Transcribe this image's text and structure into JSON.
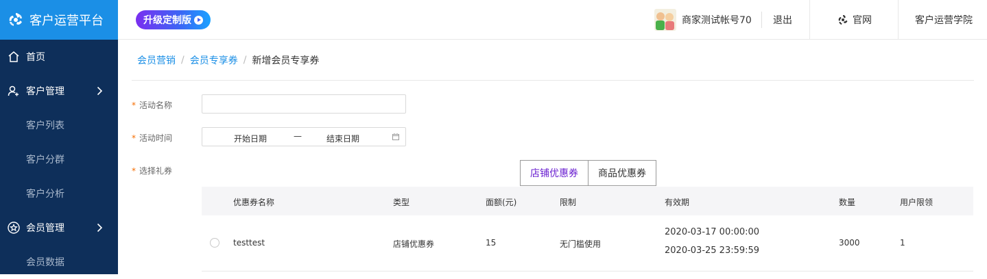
{
  "header": {
    "app_title": "客户运营平台",
    "upgrade_label": "升级定制版",
    "account_name": "商家测试帐号70",
    "logout_label": "退出",
    "official_site_label": "官网",
    "academy_label": "客户运营学院"
  },
  "sidebar": {
    "items": [
      {
        "label": "首页",
        "icon": "home-icon"
      },
      {
        "label": "客户管理",
        "icon": "customer-icon"
      },
      {
        "label": "客户列表"
      },
      {
        "label": "客户分群"
      },
      {
        "label": "客户分析"
      },
      {
        "label": "会员管理",
        "icon": "star-icon"
      },
      {
        "label": "会员数据"
      }
    ]
  },
  "breadcrumb": {
    "level1": "会员营销",
    "level2": "会员专享券",
    "current": "新增会员专享券",
    "separator": "/"
  },
  "form": {
    "name_label": "活动名称",
    "name_value": "",
    "time_label": "活动时间",
    "start_placeholder": "开始日期",
    "range_separator": "—",
    "end_placeholder": "结束日期",
    "coupon_label": "选择礼券",
    "required_mark": "*"
  },
  "tabs": [
    {
      "label": "店铺优惠券",
      "active": true
    },
    {
      "label": "商品优惠券",
      "active": false
    }
  ],
  "table": {
    "columns": [
      "优惠券名称",
      "类型",
      "面额(元)",
      "限制",
      "有效期",
      "数量",
      "用户限领"
    ],
    "rows": [
      {
        "name": "testtest",
        "type": "店铺优惠券",
        "amount": "15",
        "limit": "无门槛使用",
        "valid_from": "2020-03-17 00:00:00",
        "valid_to": "2020-03-25 23:59:59",
        "quantity": "3000",
        "per_user": "1"
      }
    ]
  },
  "colors": {
    "brand_blue": "#1b8fe6",
    "sidebar_bg": "#0e2f5a",
    "active_tab": "#6a1fd0",
    "required": "#f56c00"
  }
}
